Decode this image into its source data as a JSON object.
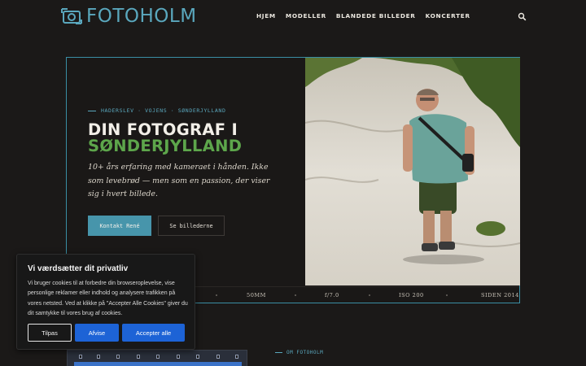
{
  "header": {
    "logo_text": "FOTOHOLM",
    "nav": [
      {
        "label": "HJEM"
      },
      {
        "label": "MODELLER"
      },
      {
        "label": "BLANDEDE BILLEDER"
      },
      {
        "label": "KONCERTER"
      }
    ],
    "search_icon": "search-icon"
  },
  "hero": {
    "eyebrow": "HADERSLEV · VOJENS · SØNDERJYLLAND",
    "title_line1": "DIN FOTOGRAF I",
    "title_line2": "SØNDERJYLLAND",
    "lead": "10+ års erfaring med kameraet i hånden. Ikke som levebrød — men som en passion, der viser sig i hvert billede.",
    "primary_button": "Kontakt René",
    "secondary_button": "Se billederne",
    "specs": [
      "50MM",
      "f/7.0",
      "ISO 200",
      "SIDEN 2014"
    ]
  },
  "about": {
    "eyebrow": "OM FOTOHOLM"
  },
  "cookie": {
    "title": "Vi værdsætter dit privatliv",
    "text": "Vi bruger cookies til at forbedre din browseroplevelse, vise personlige reklamer eller indhold og analysere trafikken på vores netsted. Ved at klikke på \"Accepter Alle Cookies\" giver du dit samtykke til vores brug af cookies.",
    "customize": "Tilpas",
    "reject": "Afvise",
    "accept": "Accepter alle"
  },
  "colors": {
    "accent_blue": "#4795ab",
    "accent_green": "#5da64b",
    "background": "#1b1918",
    "cookie_button": "#1d63d6"
  }
}
